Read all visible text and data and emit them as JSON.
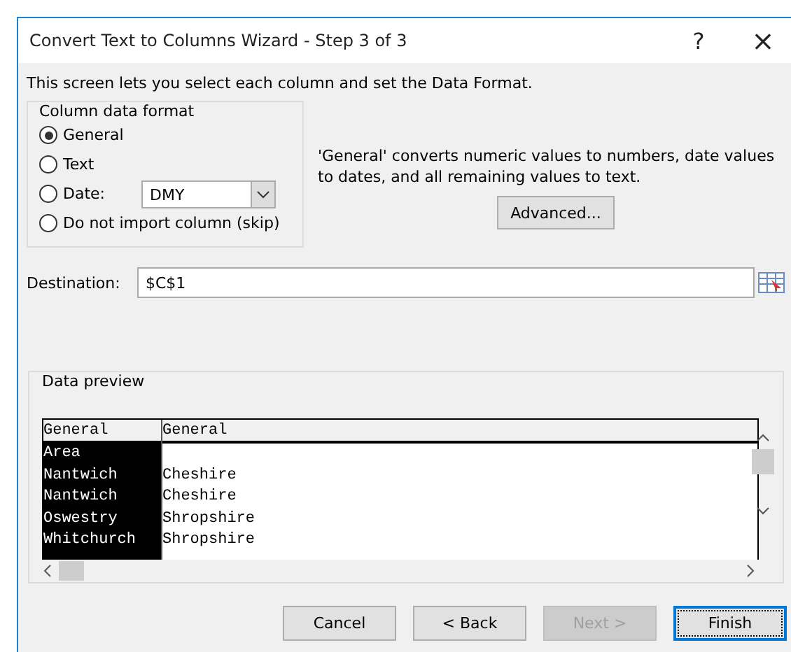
{
  "window": {
    "title": "Convert Text to Columns Wizard - Step 3 of 3",
    "help": "?",
    "close": "×"
  },
  "intro": "This screen lets you select each column and set the Data Format.",
  "format_group": {
    "title": "Column data format",
    "options": [
      {
        "kind": "plain",
        "label": "General",
        "selected": true
      },
      {
        "kind": "plain",
        "label": "Text",
        "selected": false
      },
      {
        "kind": "date",
        "label": "Date:",
        "selected": false,
        "value": "DMY"
      },
      {
        "kind": "plain",
        "label": "Do not import column (skip)",
        "selected": false
      }
    ]
  },
  "description": "'General' converts numeric values to numbers, date values to dates, and all remaining values to text.",
  "advanced_button": "Advanced...",
  "destination": {
    "label": "Destination:",
    "value": "$C$1"
  },
  "preview": {
    "title": "Data preview",
    "columns": [
      {
        "header": "General",
        "selected": true,
        "cells": [
          "Area",
          "Nantwich",
          "Nantwich",
          "Oswestry",
          "Whitchurch"
        ]
      },
      {
        "header": "General",
        "selected": false,
        "cells": [
          "",
          "Cheshire",
          "Cheshire",
          "Shropshire",
          "Shropshire"
        ]
      }
    ]
  },
  "buttons": [
    {
      "label": "Cancel",
      "disabled": false,
      "default": false
    },
    {
      "label": "< Back",
      "disabled": false,
      "default": false
    },
    {
      "label": "Next >",
      "disabled": true,
      "default": false
    },
    {
      "label": "Finish",
      "disabled": false,
      "default": true
    }
  ]
}
